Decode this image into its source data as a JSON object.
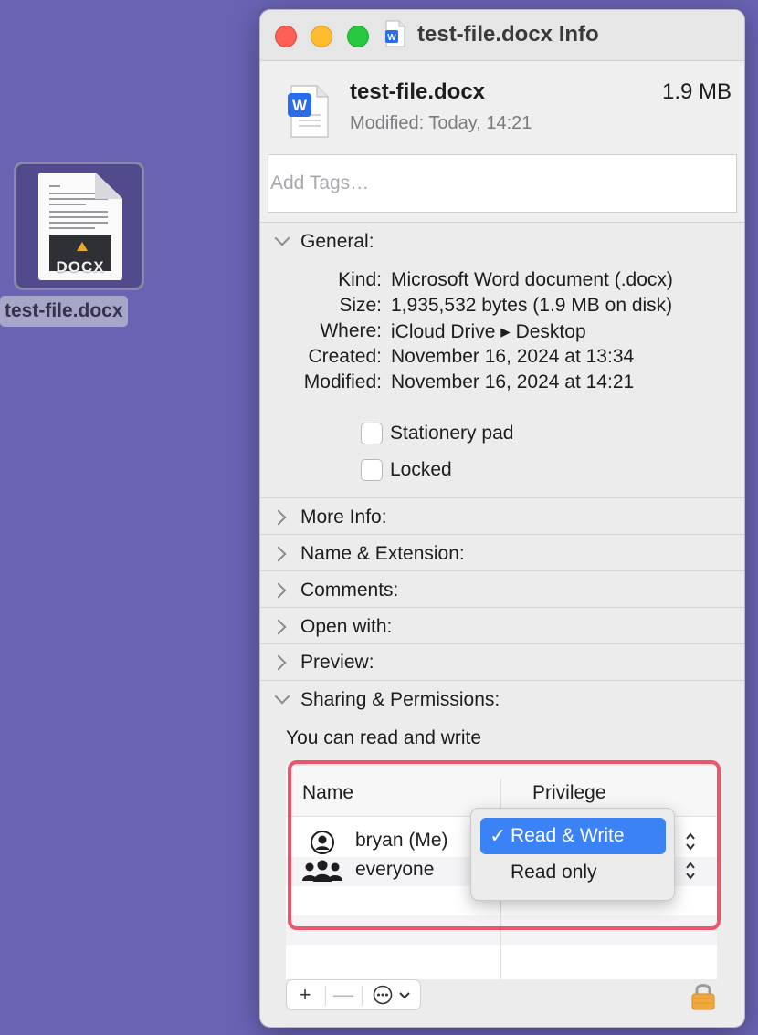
{
  "desktop": {
    "file_label": "test-file.docx",
    "icon_ext": "DOCX"
  },
  "window": {
    "title": "test-file.docx Info",
    "file_name": "test-file.docx",
    "file_size": "1.9 MB",
    "modified_label": "Modified:",
    "modified_value": "Today, 14:21",
    "tags_placeholder": "Add Tags…"
  },
  "general": {
    "title": "General:",
    "rows": [
      {
        "key": "Kind:",
        "value": "Microsoft Word document (.docx)"
      },
      {
        "key": "Size:",
        "value": "1,935,532 bytes (1.9 MB on disk)"
      },
      {
        "key": "Where:",
        "value": "iCloud Drive ▸ Desktop"
      },
      {
        "key": "Created:",
        "value": "November 16, 2024 at 13:34"
      },
      {
        "key": "Modified:",
        "value": "November 16, 2024 at 14:21"
      }
    ],
    "stationery_label": "Stationery pad",
    "locked_label": "Locked"
  },
  "sections": [
    {
      "title": "More Info:"
    },
    {
      "title": "Name & Extension:"
    },
    {
      "title": "Comments:"
    },
    {
      "title": "Open with:"
    },
    {
      "title": "Preview:"
    }
  ],
  "sharing": {
    "title": "Sharing & Permissions:",
    "summary": "You can read and write",
    "col_name": "Name",
    "col_privilege": "Privilege",
    "users": [
      {
        "name": "bryan (Me)",
        "icon": "person-circle-icon"
      },
      {
        "name": "everyone",
        "icon": "group-icon"
      }
    ],
    "popup": {
      "selected": "Read & Write",
      "checkmark": "✓",
      "other": "Read only"
    }
  },
  "toolbar": {
    "add": "+",
    "remove": "—",
    "more": "⋯"
  },
  "colors": {
    "desktop": "#6a63b4",
    "accent": "#3b82f6",
    "highlight": "#f0546a"
  }
}
